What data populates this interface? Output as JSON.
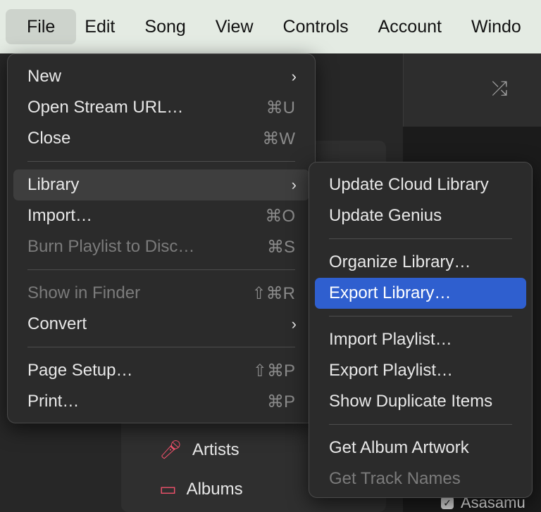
{
  "menubar": {
    "items": [
      "File",
      "Edit",
      "Song",
      "View",
      "Controls",
      "Account",
      "Windo"
    ]
  },
  "file_menu": {
    "items": [
      {
        "label": "New",
        "shortcut": "",
        "submenu": true,
        "disabled": false
      },
      {
        "label": "Open Stream URL…",
        "shortcut": "⌘U",
        "submenu": false,
        "disabled": false
      },
      {
        "label": "Close",
        "shortcut": "⌘W",
        "submenu": false,
        "disabled": false
      },
      {
        "label": "Library",
        "shortcut": "",
        "submenu": true,
        "disabled": false
      },
      {
        "label": "Import…",
        "shortcut": "⌘O",
        "submenu": false,
        "disabled": false
      },
      {
        "label": "Burn Playlist to Disc…",
        "shortcut": "⌘S",
        "submenu": false,
        "disabled": true
      },
      {
        "label": "Show in Finder",
        "shortcut": "⇧⌘R",
        "submenu": false,
        "disabled": true
      },
      {
        "label": "Convert",
        "shortcut": "",
        "submenu": true,
        "disabled": false
      },
      {
        "label": "Page Setup…",
        "shortcut": "⇧⌘P",
        "submenu": false,
        "disabled": false
      },
      {
        "label": "Print…",
        "shortcut": "⌘P",
        "submenu": false,
        "disabled": false
      }
    ]
  },
  "library_menu": {
    "items": [
      {
        "label": "Update Cloud Library",
        "disabled": false
      },
      {
        "label": "Update Genius",
        "disabled": false
      },
      {
        "label": "Organize Library…",
        "disabled": false
      },
      {
        "label": "Export Library…",
        "disabled": false,
        "selected": true
      },
      {
        "label": "Import Playlist…",
        "disabled": false
      },
      {
        "label": "Export Playlist…",
        "disabled": false
      },
      {
        "label": "Show Duplicate Items",
        "disabled": false
      },
      {
        "label": "Get Album Artwork",
        "disabled": false
      },
      {
        "label": "Get Track Names",
        "disabled": true
      }
    ]
  },
  "background": {
    "sidebar_items": [
      {
        "label": "Artists",
        "icon": "microphone-icon"
      },
      {
        "label": "Albums",
        "icon": "album-stack-icon"
      }
    ],
    "bottom_row_text": "Asasamu",
    "toolbar_icon": "shuffle-icon",
    "colors": {
      "accent_selected": "#2f5fcf",
      "sidebar_icon": "#f0516b"
    }
  }
}
